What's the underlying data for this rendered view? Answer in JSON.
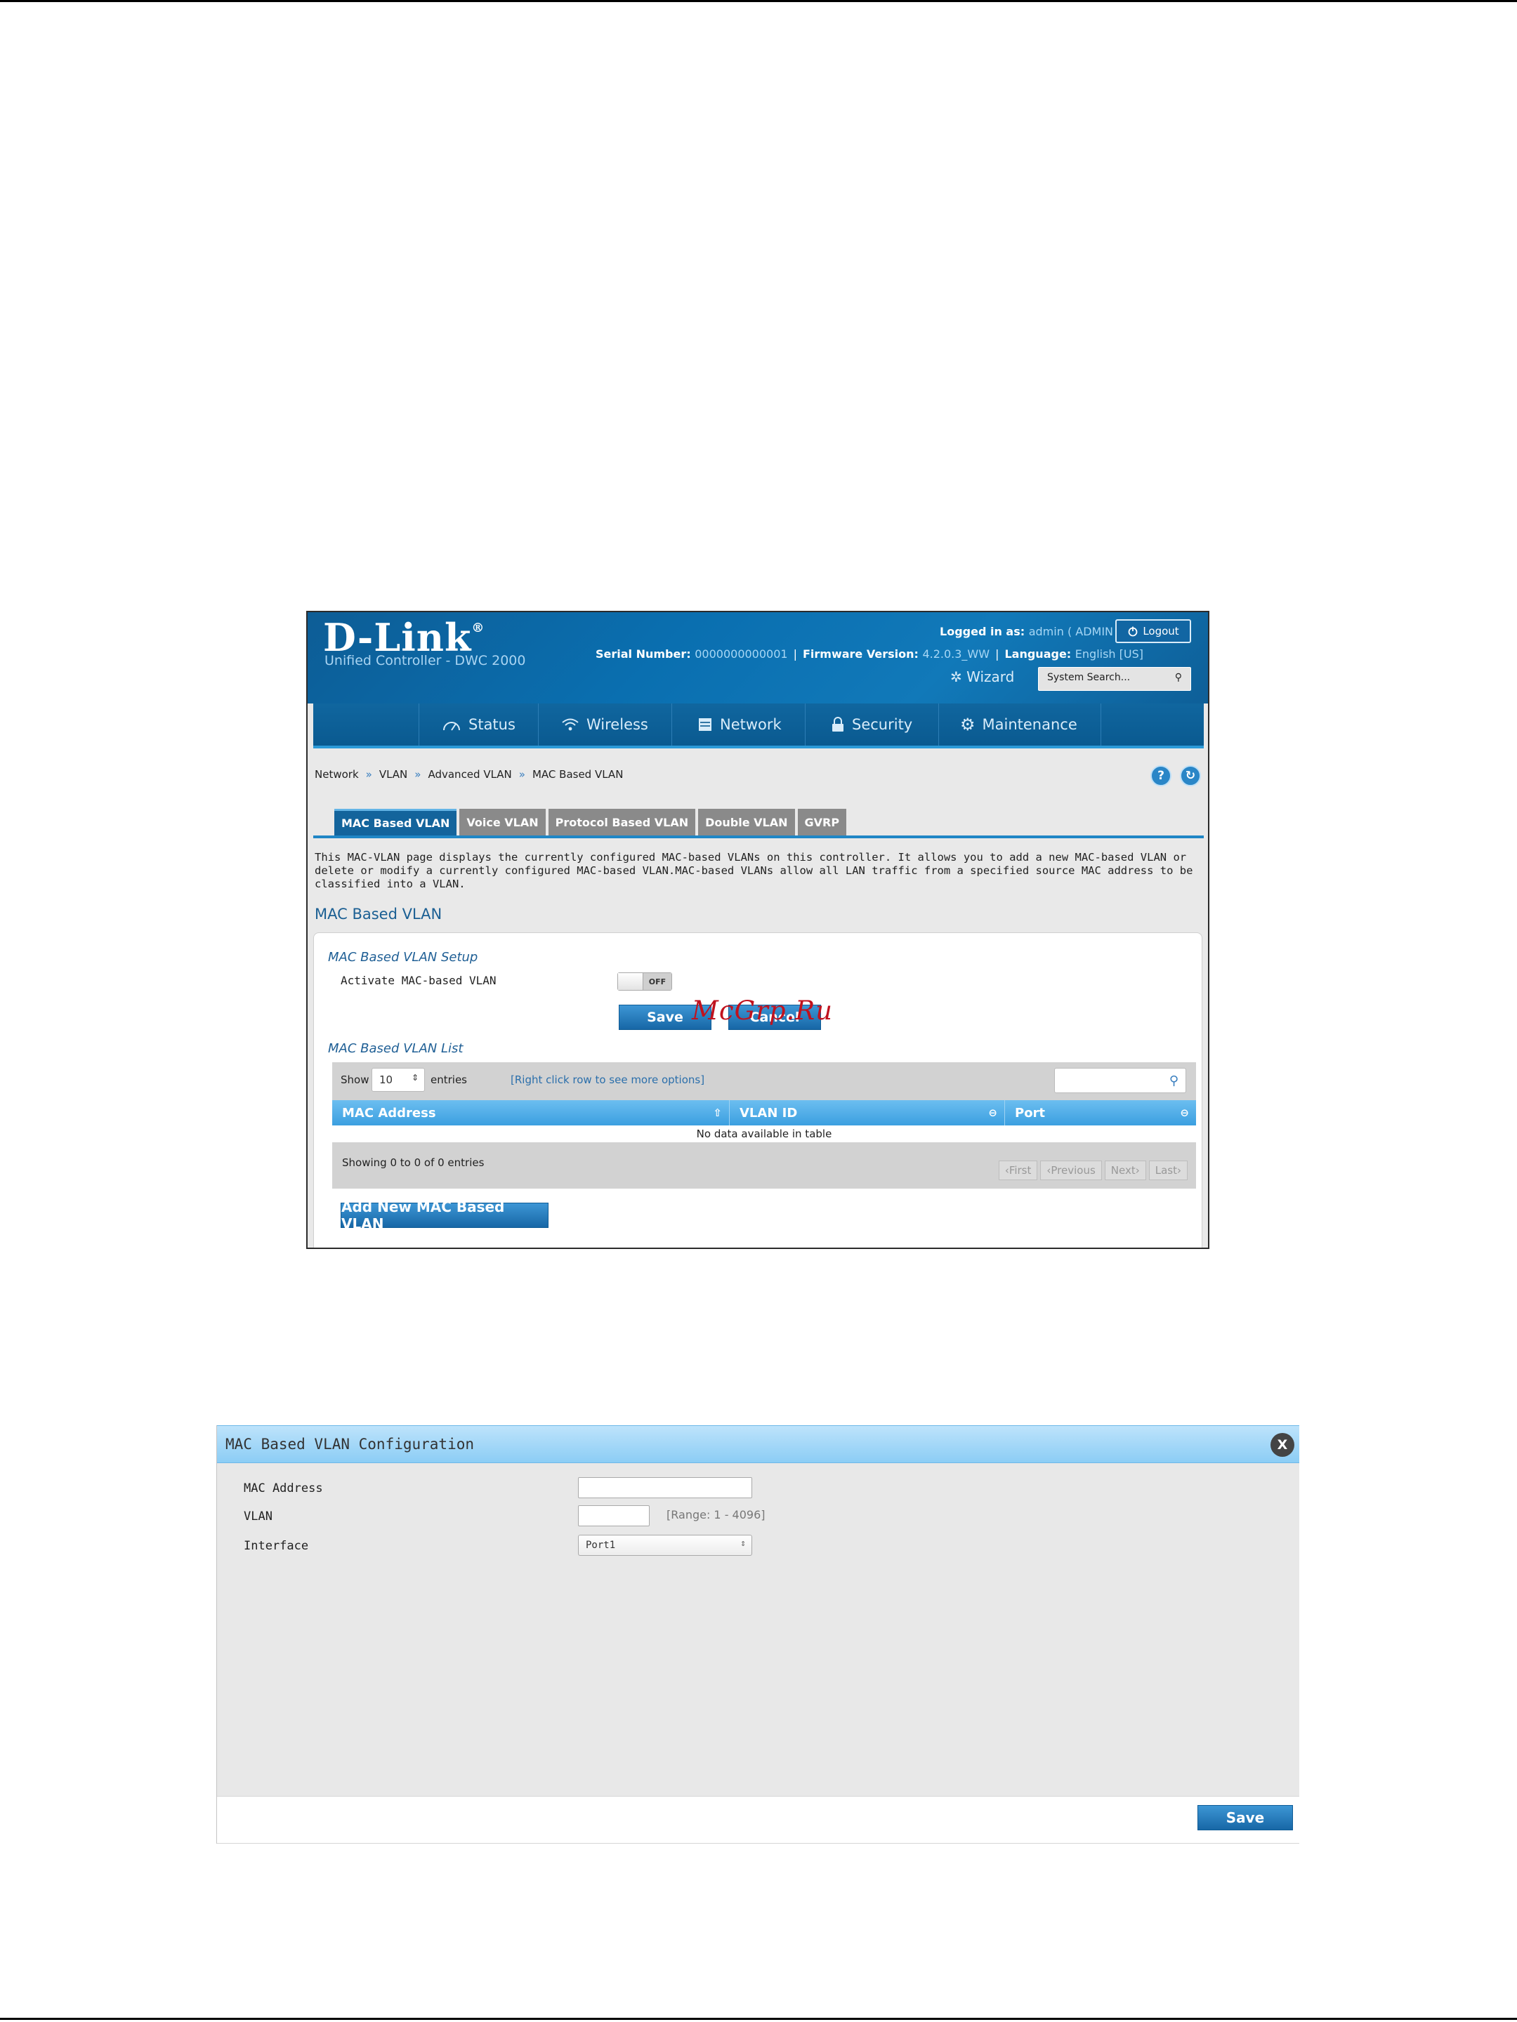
{
  "header": {
    "logo": "D-Link",
    "logo_mark": "®",
    "product": "Unified Controller - DWC 2000",
    "logged_label": "Logged in as:",
    "logged_user": "admin ( ADMIN )",
    "logout": "Logout",
    "serial_label": "Serial Number:",
    "serial_value": "0000000000001",
    "firmware_label": "Firmware Version:",
    "firmware_value": "4.2.0.3_WW",
    "language_label": "Language:",
    "language_value": "English [US]",
    "separator": "|",
    "wizard": "Wizard",
    "search_placeholder": "System Search...",
    "search_icon": "magnifier-icon"
  },
  "nav": {
    "items": [
      {
        "label": "Status",
        "icon": "gauge-icon"
      },
      {
        "label": "Wireless",
        "icon": "wifi-icon"
      },
      {
        "label": "Network",
        "icon": "server-icon"
      },
      {
        "label": "Security",
        "icon": "lock-icon"
      },
      {
        "label": "Maintenance",
        "icon": "gears-icon"
      }
    ]
  },
  "breadcrumb": {
    "items": [
      "Network",
      "VLAN",
      "Advanced VLAN",
      "MAC Based VLAN"
    ],
    "sep": "»"
  },
  "help": {
    "help_glyph": "?",
    "info_glyph": "↻"
  },
  "tabs": [
    "MAC Based VLAN",
    "Voice VLAN",
    "Protocol Based VLAN",
    "Double VLAN",
    "GVRP"
  ],
  "description": "This MAC-VLAN page displays the currently configured MAC-based VLANs on this controller. It allows you to add a new MAC-based VLAN or delete or modify a currently configured MAC-based VLAN.MAC-based VLANs allow all LAN traffic from a specified source MAC address to be classified into a VLAN.",
  "section_title": "MAC Based VLAN",
  "setup": {
    "title": "MAC Based VLAN Setup",
    "activate_label": "Activate MAC-based VLAN",
    "toggle_state": "OFF",
    "save": "Save",
    "cancel": "Cancel"
  },
  "list": {
    "title": "MAC Based VLAN List",
    "show_label": "Show",
    "entries_value": "10",
    "entries_label": "entries",
    "hint": "[Right click row to see more options]",
    "columns": [
      "MAC Address",
      "VLAN ID",
      "Port"
    ],
    "sort_glyphs": [
      "⇧",
      "⊖",
      "⊖"
    ],
    "no_data": "No data available in table",
    "showing": "Showing 0 to 0 of 0 entries",
    "pager": [
      "First",
      "Previous",
      "Next",
      "Last"
    ],
    "add_button": "Add New MAC Based VLAN"
  },
  "watermark": "McGrp.Ru",
  "dialog": {
    "title": "MAC Based VLAN Configuration",
    "close": "X",
    "mac_label": "MAC Address",
    "mac_value": "",
    "vlan_label": "VLAN",
    "vlan_value": "",
    "vlan_range": "[Range: 1 - 4096]",
    "interface_label": "Interface",
    "interface_value": "Port1",
    "save": "Save"
  }
}
